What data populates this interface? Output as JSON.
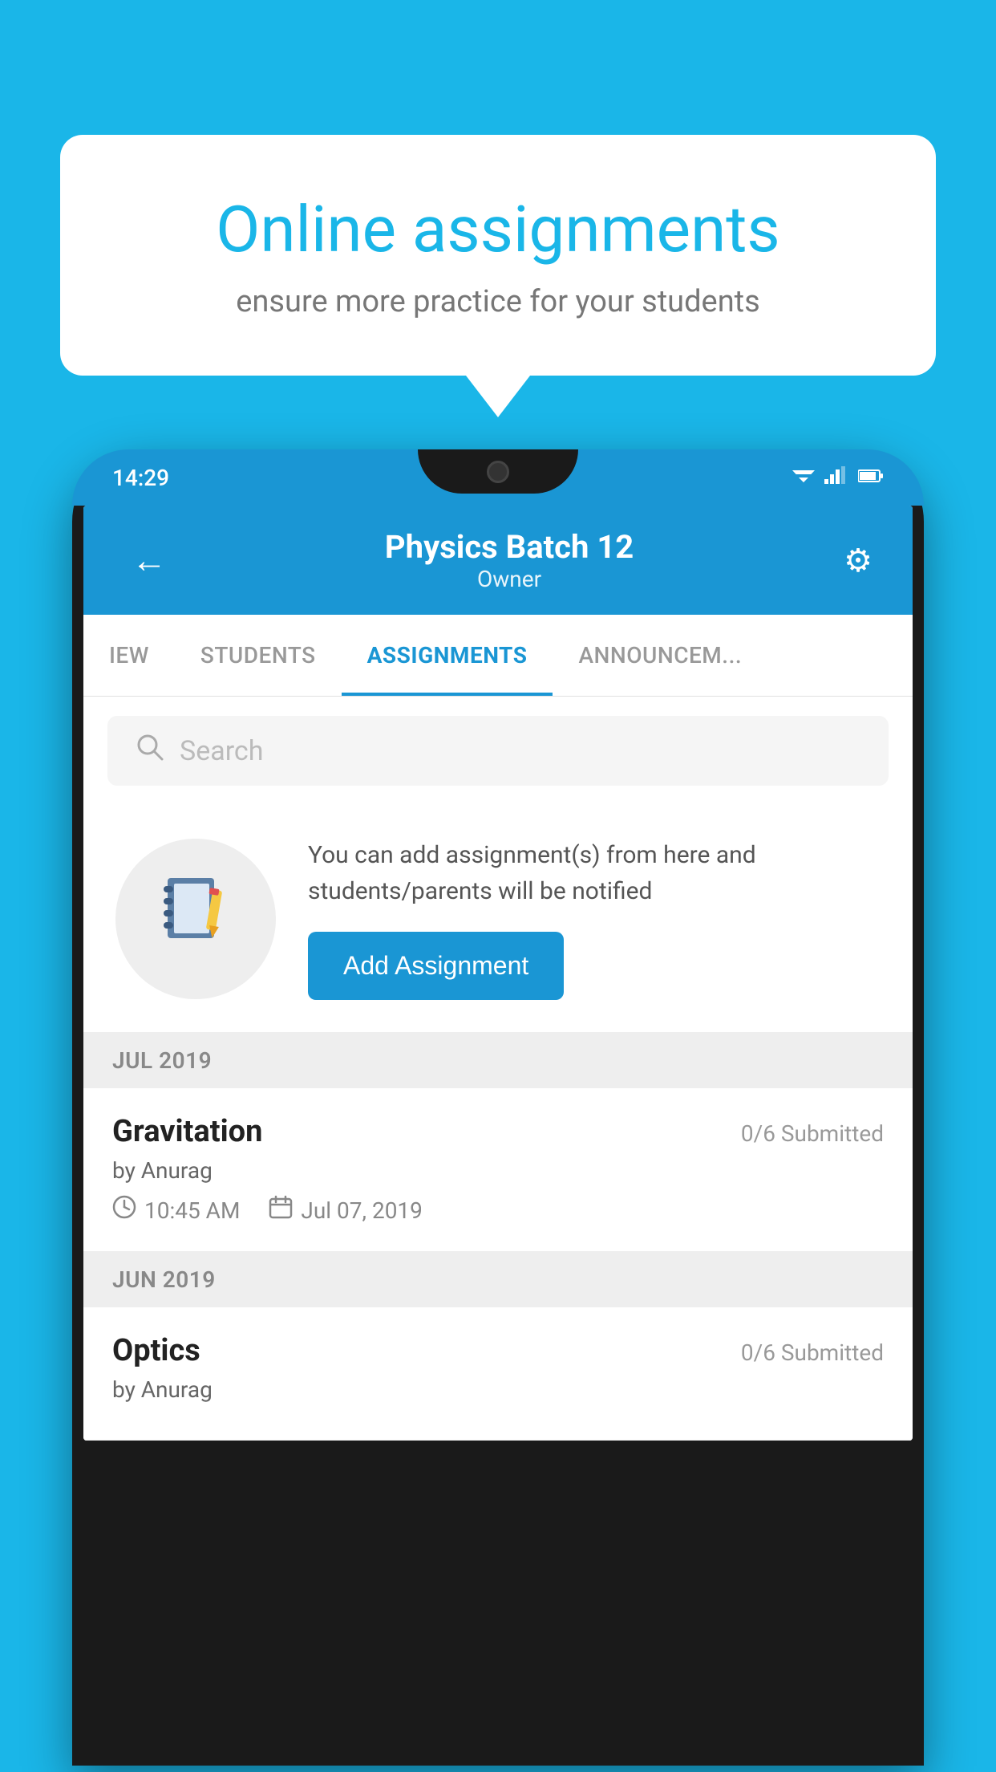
{
  "background": {
    "color": "#1ab6e8"
  },
  "speech_bubble": {
    "title": "Online assignments",
    "subtitle": "ensure more practice for your students"
  },
  "status_bar": {
    "time": "14:29",
    "wifi": "▾",
    "signal": "▴",
    "battery": "▮"
  },
  "app_header": {
    "back_icon": "←",
    "title": "Physics Batch 12",
    "subtitle": "Owner",
    "settings_icon": "⚙"
  },
  "tabs": [
    {
      "label": "IEW",
      "active": false
    },
    {
      "label": "STUDENTS",
      "active": false
    },
    {
      "label": "ASSIGNMENTS",
      "active": true
    },
    {
      "label": "ANNOUNCEMENTS",
      "active": false
    }
  ],
  "search": {
    "placeholder": "Search",
    "icon": "🔍"
  },
  "promo": {
    "description": "You can add assignment(s) from here and students/parents will be notified",
    "button_label": "Add Assignment"
  },
  "sections": [
    {
      "month_label": "JUL 2019",
      "assignments": [
        {
          "name": "Gravitation",
          "submitted": "0/6 Submitted",
          "by": "by Anurag",
          "time": "10:45 AM",
          "date": "Jul 07, 2019"
        }
      ]
    },
    {
      "month_label": "JUN 2019",
      "assignments": [
        {
          "name": "Optics",
          "submitted": "0/6 Submitted",
          "by": "by Anurag",
          "time": "",
          "date": ""
        }
      ]
    }
  ]
}
